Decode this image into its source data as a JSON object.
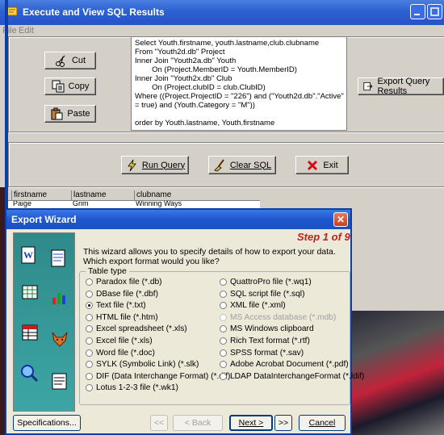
{
  "main": {
    "title": "Execute and View SQL Results",
    "menu": [
      "File",
      "Edit"
    ],
    "buttons": {
      "cut": "Cut",
      "copy": "Copy",
      "paste": "Paste",
      "export": "Export Query Results",
      "run": "Run Query",
      "clear": "Clear SQL",
      "exit": "Exit"
    },
    "sql": "Select Youth.firstname, youth.lastname,club.clubname\nFrom \"Youth2d.db\" Project\nInner Join \"Youth2a.db\" Youth\n        On (Project.MemberID = Youth.MemberID)\nInner Join \"Youth2x.db\" Club\n        On (Project.clubID = club.ClubID)\nWhere ((Project.ProjectID = \"226\") and (\"Youth2d.db\".\"Active\"\n= true) and (Youth.Category = \"M\"))\n\norder by Youth.lastname, Youth.firstname",
    "grid": {
      "columns": [
        "firstname",
        "lastname",
        "clubname"
      ],
      "rows": [
        [
          "Paige",
          "Grim",
          "Winning Ways"
        ]
      ]
    }
  },
  "wizard": {
    "title": "Export Wizard",
    "step": "Step 1 of 9",
    "intro": "This wizard allows you to specify details of how to export your data. Which export format would you like?",
    "group_label": "Table type",
    "options_left": [
      {
        "label": "Paradox file (*.db)",
        "checked": false
      },
      {
        "label": "DBase file (*.dbf)",
        "checked": false
      },
      {
        "label": "Text file (*.txt)",
        "checked": true
      },
      {
        "label": "HTML file (*.htm)",
        "checked": false
      },
      {
        "label": "Excel spreadsheet (*.xls)",
        "checked": false
      },
      {
        "label": "Excel file (*.xls)",
        "checked": false
      },
      {
        "label": "Word file (*.doc)",
        "checked": false
      },
      {
        "label": "SYLK (Symbolic Link) (*.slk)",
        "checked": false
      },
      {
        "label": "DIF (Data Interchange Format) (*.dif)",
        "checked": false
      },
      {
        "label": "Lotus 1-2-3 file (*.wk1)",
        "checked": false
      }
    ],
    "options_right": [
      {
        "label": "QuattroPro file (*.wq1)",
        "disabled": false
      },
      {
        "label": "SQL script file (*.sql)",
        "disabled": false
      },
      {
        "label": "XML file (*.xml)",
        "disabled": false
      },
      {
        "label": "MS Access database (*.mdb)",
        "disabled": true
      },
      {
        "label": "MS Windows clipboard",
        "disabled": false
      },
      {
        "label": "Rich Text format (*.rtf)",
        "disabled": false
      },
      {
        "label": "SPSS format (*.sav)",
        "disabled": false
      },
      {
        "label": "Adobe Acrobat Document (*.pdf)",
        "disabled": false
      },
      {
        "label": "LDAP DataInterchangeFormat (*.ldif)",
        "disabled": false
      }
    ],
    "buttons": {
      "specifications": "Specifications...",
      "first": "<<",
      "back": "< Back",
      "next": "Next >",
      "last": ">>",
      "cancel": "Cancel"
    }
  },
  "colors": {
    "title_blue": "#2455c7",
    "step_red": "#c0201e",
    "wizard_side": "#3da5a5"
  }
}
